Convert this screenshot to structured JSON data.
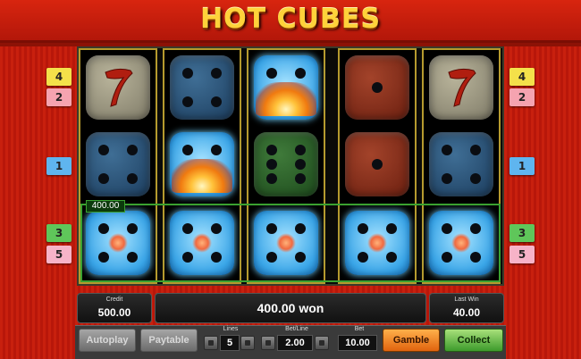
{
  "game": {
    "title": "HOT CUBES"
  },
  "paylines": {
    "left": [
      "4",
      "2",
      "1",
      "3",
      "5"
    ],
    "right": [
      "4",
      "2",
      "1",
      "3",
      "5"
    ]
  },
  "reels": [
    [
      {
        "face": "seven",
        "color": "beige"
      },
      {
        "face": "4",
        "color": "blue"
      },
      {
        "face": "4",
        "color": "lit",
        "win": true
      }
    ],
    [
      {
        "face": "4",
        "color": "blue"
      },
      {
        "face": "4",
        "color": "lit",
        "fire": true
      },
      {
        "face": "4",
        "color": "lit",
        "win": true
      }
    ],
    [
      {
        "face": "4",
        "color": "lit",
        "fire": true
      },
      {
        "face": "6",
        "color": "green"
      },
      {
        "face": "4",
        "color": "lit",
        "win": true
      }
    ],
    [
      {
        "face": "1",
        "color": "red"
      },
      {
        "face": "1",
        "color": "red"
      },
      {
        "face": "4",
        "color": "lit",
        "win": true
      }
    ],
    [
      {
        "face": "seven",
        "color": "beige"
      },
      {
        "face": "4",
        "color": "blue"
      },
      {
        "face": "4",
        "color": "lit",
        "win": true
      }
    ]
  ],
  "win_tag": "400.00",
  "credit": {
    "label": "Credit",
    "value": "500.00"
  },
  "message": {
    "value": "400.00 won"
  },
  "last_win": {
    "label": "Last Win",
    "value": "40.00"
  },
  "controls": {
    "autoplay": "Autoplay",
    "paytable": "Paytable",
    "lines_label": "Lines",
    "lines_value": "5",
    "betline_label": "Bet/Line",
    "betline_value": "2.00",
    "bet_label": "Bet",
    "bet_value": "10.00",
    "gamble": "Gamble",
    "collect": "Collect"
  },
  "colors": {
    "background": "#c41a0a",
    "title": "#ffd23a",
    "win_outline": "#3aa130",
    "line_1": "#5fb5ef",
    "line_2": "#f5a3b0",
    "line_3": "#5fc65a",
    "line_4": "#f4e14a",
    "line_5": "#f7b3c8"
  }
}
